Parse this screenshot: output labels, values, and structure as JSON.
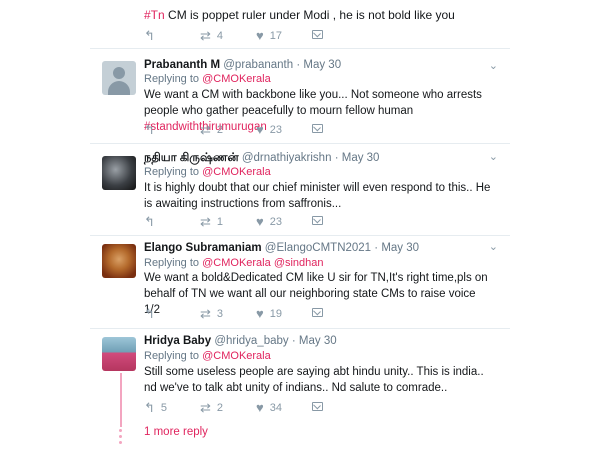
{
  "top": {
    "hashtag": "#Tn",
    "rest": " CM is poppet ruler under Modi , he is not bold like you",
    "actions": {
      "retweets": "4",
      "likes": "17"
    }
  },
  "tweets": [
    {
      "name": "Prabananth M",
      "handle": "@prabananth",
      "time": "May 30",
      "replying_label": "Replying to",
      "replying_to": "@CMOKerala",
      "text": "We want a CM with backbone like you... Not someone who arrests people who gather peacefully to mourn fellow human ",
      "hashtag": "#standwiththirumurugan",
      "retweets": "2",
      "likes": "23"
    },
    {
      "name": "நதியா கிருஷ்ணன்",
      "handle": "@drnathiyakrishn",
      "time": "May 30",
      "replying_label": "Replying to",
      "replying_to": "@CMOKerala",
      "text": "It is highly doubt that our chief minister will even respond to this.. He is awaiting instructions from saffronis...",
      "retweets": "1",
      "likes": "23"
    },
    {
      "name": "Elango Subramaniam",
      "handle": "@ElangoCMTN2021",
      "time": "May 30",
      "replying_label": "Replying to",
      "replying_to": "@CMOKerala",
      "replying_to_2": "@sindhan",
      "text": "We want a bold&Dedicated CM like U sir for TN,It's right time,pls on behalf of TN we want all our neighboring state CMs to raise voice 1/2",
      "retweets": "3",
      "likes": "19"
    },
    {
      "name": "Hridya Baby",
      "handle": "@hridya_baby",
      "time": "May 30",
      "replying_label": "Replying to",
      "replying_to": "@CMOKerala",
      "text": "Still some useless people are saying abt hindu unity.. This is india.. nd we've to talk abt unity of indians.. Nd salute to comrade..",
      "replies": "5",
      "retweets": "2",
      "likes": "34"
    }
  ],
  "more_reply": "1 more reply",
  "icons": {
    "reply": "reply-icon",
    "retweet": "retweet-icon",
    "like": "heart-icon",
    "dm": "direct-message-icon",
    "menu": "chevron-down-icon"
  },
  "colors": {
    "accent": "#e0245e",
    "muted": "#657786",
    "thread": "#f3a5c0"
  }
}
